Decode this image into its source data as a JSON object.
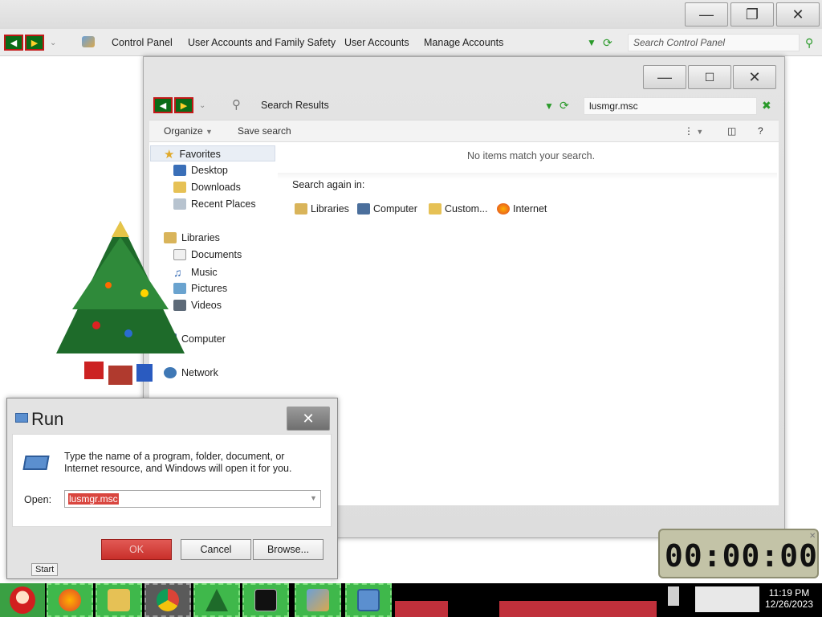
{
  "control_panel": {
    "breadcrumb": [
      "Control Panel",
      "User Accounts and Family Safety",
      "User Accounts",
      "Manage Accounts"
    ],
    "search_placeholder": "Search Control Panel",
    "caption": {
      "minimize": "—",
      "restore": "❐",
      "close": "✕"
    }
  },
  "search_window": {
    "location": "Search Results",
    "query": "lusmgr.msc",
    "toolbar": {
      "organize": "Organize",
      "save_search": "Save search"
    },
    "nav": {
      "favorites": "Favorites",
      "favorites_items": [
        "Desktop",
        "Downloads",
        "Recent Places"
      ],
      "libraries": "Libraries",
      "libraries_items": [
        "Documents",
        "Music",
        "Pictures",
        "Videos"
      ],
      "computer": "Computer",
      "network": "Network"
    },
    "empty_message": "No items match your search.",
    "search_again_label": "Search again in:",
    "search_again": [
      "Libraries",
      "Computer",
      "Custom...",
      "Internet"
    ]
  },
  "run_dialog": {
    "title": "Run",
    "description": "Type the name of a program, folder, document, or Internet resource, and Windows will open it for you.",
    "open_label": "Open:",
    "open_value": "lusmgr.msc",
    "buttons": {
      "ok": "OK",
      "cancel": "Cancel",
      "browse": "Browse..."
    }
  },
  "start_tooltip": "Start",
  "clock_gadget": {
    "time": "00:00:00"
  },
  "tray": {
    "time": "11:19 PM",
    "date": "12/26/2023"
  },
  "taskbar_items": [
    "firefox-icon",
    "file-explorer-icon",
    "chrome-icon",
    "christmas-tree-icon",
    "command-prompt-icon",
    "control-panel-icon",
    "run-icon"
  ],
  "colors": {
    "nav_green": "#0b6b17",
    "nav_red": "#c21818",
    "taskbar_green": "#3fb84b",
    "ok_red": "#d0403b"
  }
}
